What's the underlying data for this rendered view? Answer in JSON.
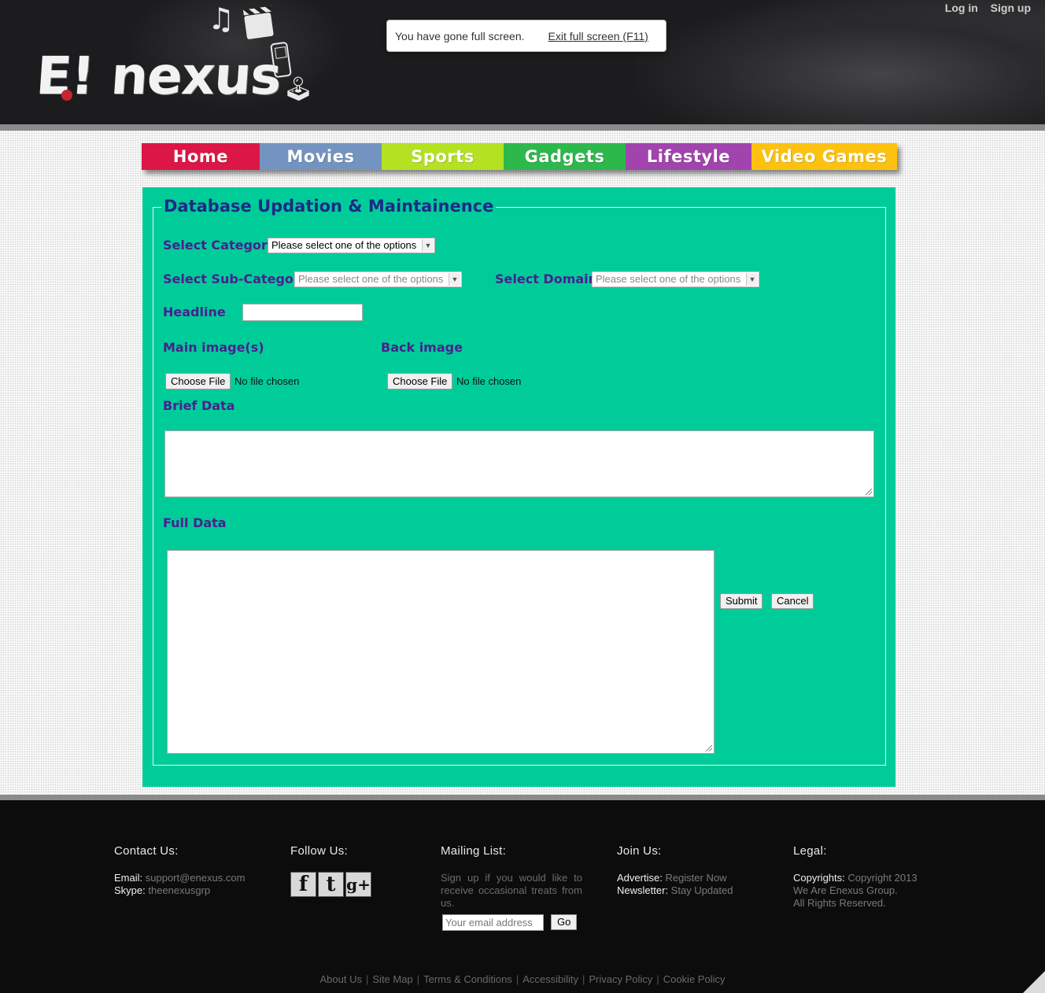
{
  "header": {
    "logo_text": "E! nexus",
    "login": "Log in",
    "signup": "Sign up"
  },
  "fullscreen_notice": {
    "message": "You have gone full screen.",
    "exit": "Exit full screen (F11)"
  },
  "nav": {
    "items": [
      {
        "label": "Home",
        "color": "#dc1747"
      },
      {
        "label": "Movies",
        "color": "#7394c0"
      },
      {
        "label": "Sports",
        "color": "#b4e122"
      },
      {
        "label": "Gadgets",
        "color": "#2db84c"
      },
      {
        "label": "Lifestyle",
        "color": "#a144ae"
      },
      {
        "label": "Video Games",
        "color": "#fdc20f"
      }
    ]
  },
  "form": {
    "legend": "Database Updation & Maintainence",
    "category_label": "Select Category :",
    "category_value": "Please select one of the options",
    "subcategory_label": "Select Sub-Category :",
    "subcategory_value": "Please select one of the options",
    "domain_label": "Select Domain :",
    "domain_value": "Please select one of the options",
    "headline_label": "Headline",
    "main_image_label": "Main image(s)",
    "back_image_label": "Back image",
    "choose_file": "Choose File",
    "no_file": "No file chosen",
    "brief_label": "Brief Data",
    "full_label": "Full Data",
    "submit": "Submit",
    "cancel": "Cancel",
    "panel_color": "#00cc9a"
  },
  "footer": {
    "contact": {
      "title": "Contact Us:",
      "email_label": "Email:",
      "email_value": "support@enexus.com",
      "skype_label": "Skype:",
      "skype_value": "theenexusgrp"
    },
    "follow": {
      "title": "Follow Us:",
      "icons": [
        "facebook-icon",
        "twitter-icon",
        "google-plus-icon"
      ],
      "glyphs": [
        "f",
        "t",
        "g+"
      ]
    },
    "mailing": {
      "title": "Mailing List:",
      "description": "Sign up if you would like to receive occasional treats from us.",
      "placeholder": "Your email address",
      "go": "Go"
    },
    "join": {
      "title": "Join Us:",
      "advertise_label": "Advertise:",
      "advertise_value": "Register Now",
      "newsletter_label": "Newsletter:",
      "newsletter_value": "Stay Updated"
    },
    "legal": {
      "title": "Legal:",
      "copyright_label": "Copyrights:",
      "copyright_value": "Copyright 2013",
      "line2": "We Are Enexus Group.",
      "line3": "All Rights Reserved."
    },
    "links": [
      "About Us",
      "Site Map",
      "Terms & Conditions",
      "Accessibility",
      "Privacy Policy",
      "Cookie Policy"
    ]
  }
}
